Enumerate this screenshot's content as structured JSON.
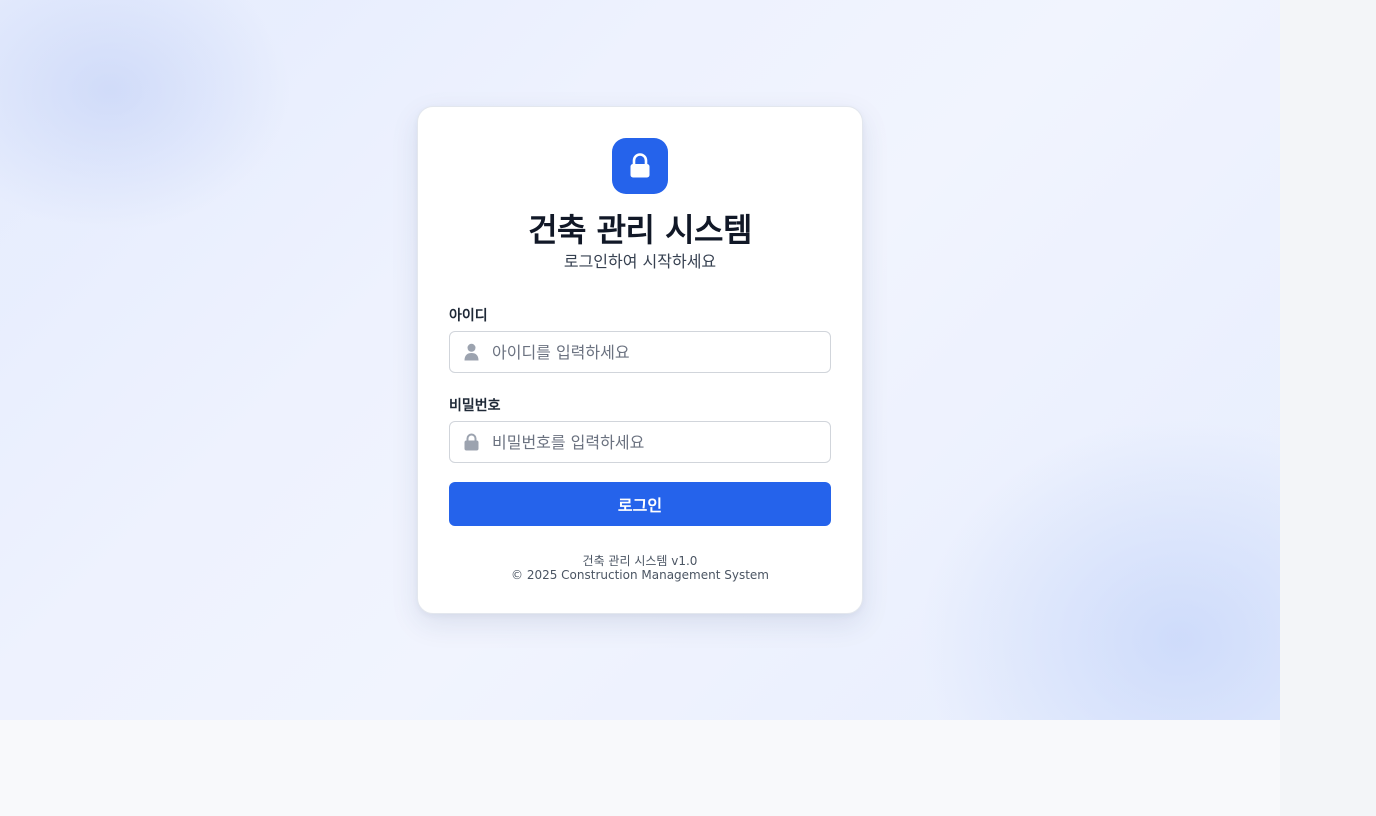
{
  "app": {
    "title": "건축 관리 시스템",
    "subtitle": "로그인하여 시작하세요"
  },
  "form": {
    "username": {
      "label": "아이디",
      "placeholder": "아이디를 입력하세요",
      "icon": "user-icon"
    },
    "password": {
      "label": "비밀번호",
      "placeholder": "비밀번호를 입력하세요",
      "icon": "lock-icon"
    },
    "submit_label": "로그인"
  },
  "footer": {
    "version": "건축 관리 시스템 v1.0",
    "copyright": "© 2025 Construction Management System"
  },
  "colors": {
    "accent": "#2563eb",
    "title": "#111827",
    "muted": "#6b7280"
  }
}
